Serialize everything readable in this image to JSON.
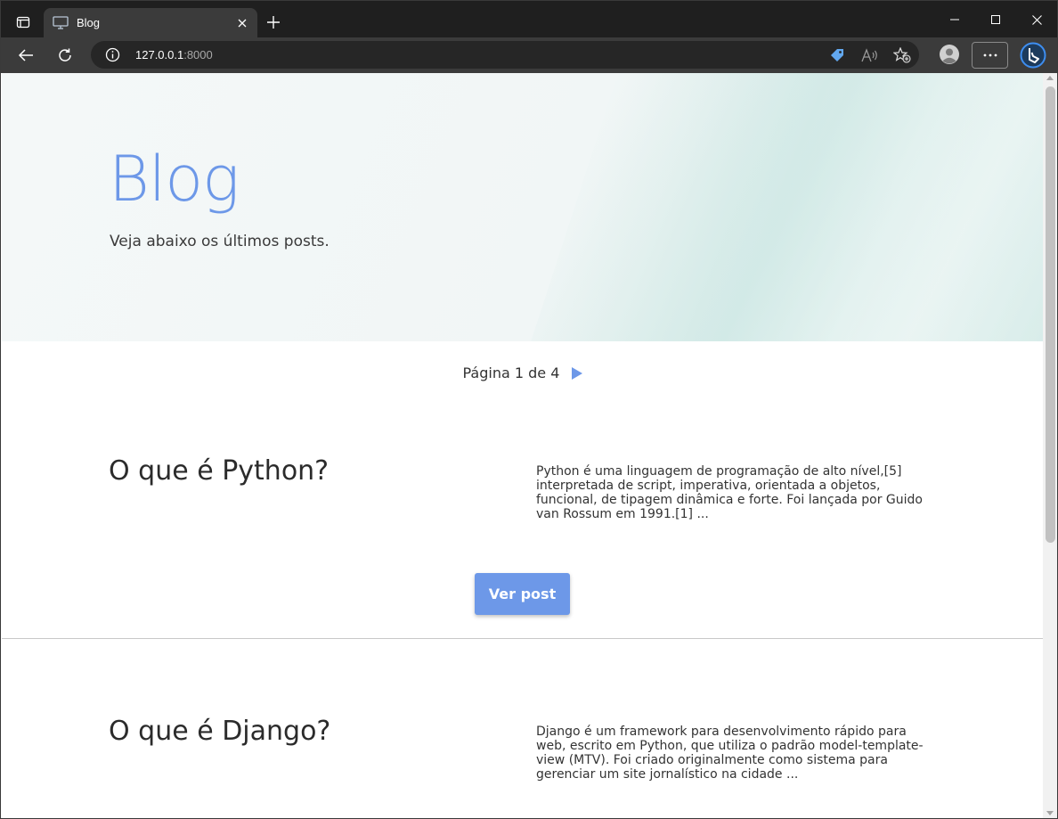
{
  "browser": {
    "tab_title": "Blog",
    "url_host": "127.0.0.1",
    "url_port": ":8000"
  },
  "hero": {
    "title": "Blog",
    "subtitle": "Veja abaixo os últimos posts."
  },
  "pagination": {
    "label": "Página 1 de 4"
  },
  "posts": [
    {
      "title": "O que é Python?",
      "excerpt": "Python é uma linguagem de programação de alto nível,[5] interpretada de script, imperativa, orientada a objetos, funcional, de tipagem dinâmica e forte. Foi lançada por Guido van Rossum em 1991.[1] ...",
      "button": "Ver post"
    },
    {
      "title": "O que é Django?",
      "excerpt": "Django é um framework para desenvolvimento rápido para web, escrito em Python, que utiliza o padrão model-template-view (MTV). Foi criado originalmente como sistema para gerenciar um site jornalístico na cidade ..."
    }
  ],
  "colors": {
    "accent": "#6d98e8",
    "browser_bg": "#1f1f1f",
    "toolbar_bg": "#3b3b3b"
  }
}
